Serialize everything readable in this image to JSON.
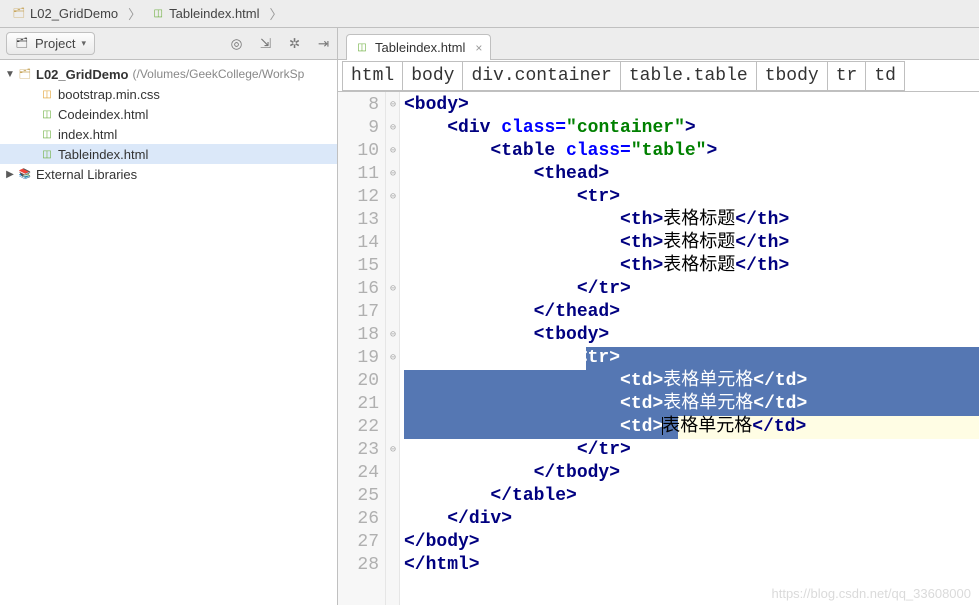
{
  "nav": {
    "crumb1": "L02_GridDemo",
    "crumb2": "Tableindex.html"
  },
  "project_panel": {
    "title": "Project",
    "root": {
      "name": "L02_GridDemo",
      "path": "(/Volumes/GeekCollege/WorkSp",
      "children": [
        {
          "name": "bootstrap.min.css",
          "icon": "js"
        },
        {
          "name": "Codeindex.html",
          "icon": "html"
        },
        {
          "name": "index.html",
          "icon": "html"
        },
        {
          "name": "Tableindex.html",
          "icon": "html",
          "selected": true
        }
      ]
    },
    "external_libs": "External Libraries"
  },
  "editor": {
    "tab_label": "Tableindex.html",
    "trail": [
      "html",
      "body",
      "div.container",
      "table.table",
      "tbody",
      "tr",
      "td"
    ],
    "first_line": 8,
    "lines": [
      {
        "indent": 0,
        "segs": [
          [
            "tag",
            "<body>"
          ]
        ]
      },
      {
        "indent": 1,
        "segs": [
          [
            "tag",
            "<div "
          ],
          [
            "attr",
            "class="
          ],
          [
            "str",
            "\"container\""
          ],
          [
            "tag",
            ">"
          ]
        ]
      },
      {
        "indent": 2,
        "segs": [
          [
            "tag",
            "<table "
          ],
          [
            "attr",
            "class="
          ],
          [
            "str",
            "\"table\""
          ],
          [
            "tag",
            ">"
          ]
        ]
      },
      {
        "indent": 3,
        "segs": [
          [
            "tag",
            "<thead>"
          ]
        ]
      },
      {
        "indent": 4,
        "segs": [
          [
            "tag",
            "<tr>"
          ]
        ]
      },
      {
        "indent": 5,
        "segs": [
          [
            "tag",
            "<th>"
          ],
          [
            "plain",
            "表格标题"
          ],
          [
            "tag",
            "</th>"
          ]
        ]
      },
      {
        "indent": 5,
        "segs": [
          [
            "tag",
            "<th>"
          ],
          [
            "plain",
            "表格标题"
          ],
          [
            "tag",
            "</th>"
          ]
        ]
      },
      {
        "indent": 5,
        "segs": [
          [
            "tag",
            "<th>"
          ],
          [
            "plain",
            "表格标题"
          ],
          [
            "tag",
            "</th>"
          ]
        ]
      },
      {
        "indent": 4,
        "segs": [
          [
            "tag",
            "</tr>"
          ]
        ]
      },
      {
        "indent": 3,
        "segs": [
          [
            "tag",
            "</thead>"
          ]
        ]
      },
      {
        "indent": 3,
        "segs": [
          [
            "tag",
            "<tbody>"
          ]
        ]
      },
      {
        "indent": 4,
        "segs": [
          [
            "tag",
            "<tr>"
          ]
        ],
        "sel": "start"
      },
      {
        "indent": 5,
        "segs": [
          [
            "tag",
            "<td>"
          ],
          [
            "plain",
            "表格单元格"
          ],
          [
            "tag",
            "</td>"
          ]
        ],
        "sel": "full"
      },
      {
        "indent": 5,
        "segs": [
          [
            "tag",
            "<td>"
          ],
          [
            "plain",
            "表格单元格"
          ],
          [
            "tag",
            "</td>"
          ]
        ],
        "sel": "full"
      },
      {
        "indent": 5,
        "segs": [
          [
            "tag",
            "<td>"
          ],
          [
            "plain",
            "表格单元格"
          ],
          [
            "tag",
            "</td>"
          ]
        ],
        "sel": "caret",
        "caret_after": 1
      },
      {
        "indent": 4,
        "segs": [
          [
            "tag",
            "</tr>"
          ]
        ]
      },
      {
        "indent": 3,
        "segs": [
          [
            "tag",
            "</tbody>"
          ]
        ]
      },
      {
        "indent": 2,
        "segs": [
          [
            "tag",
            "</table>"
          ]
        ]
      },
      {
        "indent": 1,
        "segs": [
          [
            "tag",
            "</div>"
          ]
        ]
      },
      {
        "indent": 0,
        "segs": [
          [
            "tag",
            "</body>"
          ]
        ]
      },
      {
        "indent": 0,
        "segs": [
          [
            "tag",
            "</html>"
          ]
        ]
      }
    ]
  },
  "watermark": "https://blog.csdn.net/qq_33608000"
}
